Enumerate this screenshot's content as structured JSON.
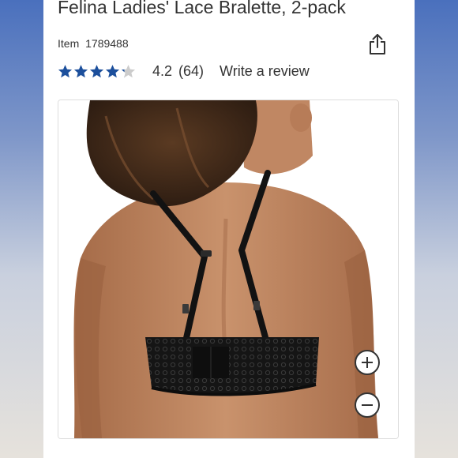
{
  "product": {
    "title": "Felina Ladies' Lace Bralette, 2-pack",
    "item_label": "Item",
    "item_number": "1789488"
  },
  "rating": {
    "value": "4.2",
    "count": "(64)",
    "stars_filled": 4.2,
    "stars_total": 5,
    "write_review_label": "Write a review"
  },
  "icons": {
    "share": "share-icon",
    "star": "star-icon",
    "zoom_in": "plus-icon",
    "zoom_out": "minus-icon"
  },
  "colors": {
    "star_filled": "#1c4f9c",
    "star_empty": "#cccccc",
    "text": "#333333",
    "page_background": "#ffffff"
  }
}
